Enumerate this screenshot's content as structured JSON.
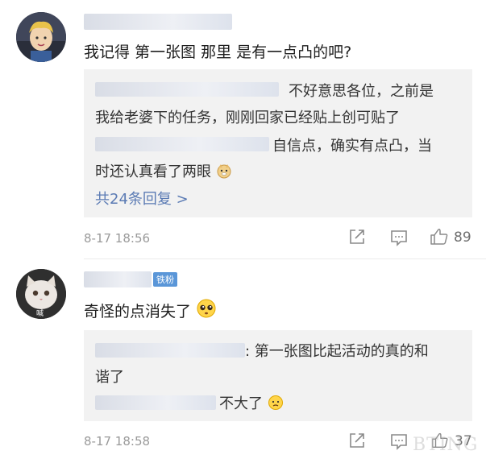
{
  "comments": [
    {
      "text": "我记得 第一张图 那里 是有一点凸的吧?",
      "reply_lines": [
        "不好意思各位，之前是",
        "我给老婆下的任务，刚刚回家已经贴上创可贴了",
        "自信点，确实有点凸，当",
        "时还认真看了两眼"
      ],
      "more_replies": "共24条回复 >",
      "time": "8-17 18:56",
      "likes": "89"
    },
    {
      "badge": "铁粉",
      "text": "奇怪的点消失了",
      "reply_lines": [
        ": 第一张图比起活动的真的和",
        "谐了",
        "不大了"
      ],
      "time": "8-17 18:58",
      "likes": "37",
      "avatar_caption": "喊"
    }
  ],
  "watermark": "BTING",
  "colors": {
    "link": "#5b7bb4",
    "badge": "#5a96d8",
    "reply_bg": "#f2f2f2"
  }
}
